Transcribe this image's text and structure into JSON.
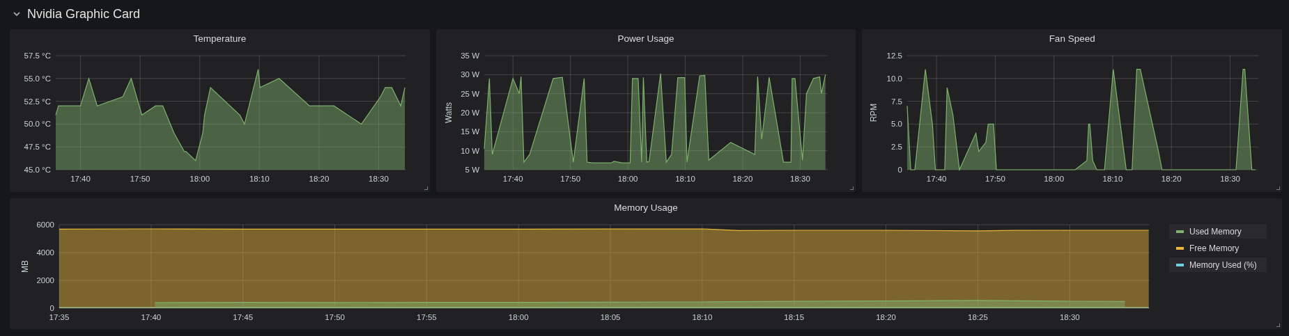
{
  "section": {
    "title": "Nvidia Graphic Card",
    "expanded": true
  },
  "panels": [
    {
      "chart_data": {
        "type": "area",
        "grid": true,
        "title": "Temperature",
        "x": [
          1055.85,
          1056.3,
          1060,
          1061.4,
          1062.8,
          1067.1,
          1068.5,
          1070.3,
          1072.6,
          1073.8,
          1075.7,
          1077.4,
          1077.7,
          1079.3,
          1080.5,
          1080.8,
          1081.8,
          1086.7,
          1087.5,
          1089.8,
          1090.1,
          1093.3,
          1098.4,
          1102.5,
          1107.1,
          1110.3,
          1111.1,
          1112.2,
          1113.7,
          1114.4
        ],
        "values": [
          51,
          52,
          52,
          55,
          52,
          53,
          55,
          51,
          52,
          52,
          49,
          47,
          47,
          46,
          49,
          51,
          54,
          51,
          50,
          56,
          54,
          55,
          52,
          52,
          50,
          53,
          54,
          54,
          52,
          54
        ],
        "xlim": [
          1055.85,
          1114.5
        ],
        "ylim": [
          45,
          57.5
        ],
        "xticks": [
          {
            "value": 1060,
            "label": "17:40"
          },
          {
            "value": 1070,
            "label": "17:50"
          },
          {
            "value": 1080,
            "label": "18:00"
          },
          {
            "value": 1090,
            "label": "18:10"
          },
          {
            "value": 1100,
            "label": "18:20"
          },
          {
            "value": 1110,
            "label": "18:30"
          }
        ],
        "yticks": [
          {
            "value": 45,
            "label": "45.0 °C"
          },
          {
            "value": 47.5,
            "label": "47.5 °C"
          },
          {
            "value": 50,
            "label": "50.0 °C"
          },
          {
            "value": 52.5,
            "label": "52.5 °C"
          },
          {
            "value": 55,
            "label": "55.0 °C"
          },
          {
            "value": 57.5,
            "label": "57.5 °C"
          }
        ]
      }
    },
    {
      "chart_data": {
        "type": "area",
        "grid": true,
        "title": "Power Usage",
        "ylabel": "Watts",
        "x": [
          1055,
          1055.9,
          1056.4,
          1060,
          1061.1,
          1061.4,
          1061.9,
          1062.9,
          1067,
          1068.6,
          1070.5,
          1072.4,
          1072.9,
          1073.8,
          1077.1,
          1077.6,
          1079,
          1080.4,
          1080.8,
          1081.8,
          1082.4,
          1082.7,
          1083.3,
          1083.7,
          1085.7,
          1086.7,
          1087.6,
          1088.7,
          1089.9,
          1090.3,
          1092.5,
          1093.4,
          1094.1,
          1097.9,
          1102.1,
          1102.6,
          1103.3,
          1104.6,
          1107.1,
          1108.4,
          1108.6,
          1109.1,
          1110.4,
          1111.1,
          1112.3,
          1113.4,
          1113.7,
          1114.4
        ],
        "values": [
          10.5,
          29,
          9,
          29,
          25,
          29.5,
          7,
          9,
          29,
          29.3,
          7,
          29,
          7,
          6.8,
          6.8,
          7.2,
          6.8,
          6.8,
          29,
          29,
          7,
          29.3,
          7,
          7.2,
          30.3,
          7,
          9,
          29.2,
          29.2,
          7,
          29.7,
          29.8,
          7.5,
          12.2,
          9,
          29.5,
          13,
          29.3,
          7,
          7,
          29,
          29,
          7.5,
          25,
          29,
          29.4,
          25,
          30
        ],
        "xlim": [
          1055,
          1114.8
        ],
        "ylim": [
          5,
          35
        ],
        "xticks": [
          {
            "value": 1060,
            "label": "17:40"
          },
          {
            "value": 1070,
            "label": "17:50"
          },
          {
            "value": 1080,
            "label": "18:00"
          },
          {
            "value": 1090,
            "label": "18:10"
          },
          {
            "value": 1100,
            "label": "18:20"
          },
          {
            "value": 1110,
            "label": "18:30"
          }
        ],
        "yticks": [
          {
            "value": 5,
            "label": "5 W"
          },
          {
            "value": 10,
            "label": "10 W"
          },
          {
            "value": 15,
            "label": "15 W"
          },
          {
            "value": 20,
            "label": "20 W"
          },
          {
            "value": 25,
            "label": "25 W"
          },
          {
            "value": 30,
            "label": "30 W"
          },
          {
            "value": 35,
            "label": "35 W"
          }
        ]
      }
    },
    {
      "chart_data": {
        "type": "area",
        "grid": true,
        "title": "Fan Speed",
        "ylabel": "RPM",
        "x": [
          1055,
          1055.6,
          1056.3,
          1058.1,
          1059.3,
          1059.8,
          1061.4,
          1061.8,
          1062.8,
          1063.9,
          1066.7,
          1067.2,
          1068.4,
          1068.8,
          1069.7,
          1070.2,
          1083.6,
          1085.6,
          1085.9,
          1086.1,
          1086.6,
          1087.3,
          1088.6,
          1090.1,
          1092.3,
          1093.3,
          1094.1,
          1094.7,
          1097.8,
          1098.4,
          1111,
          1112.2,
          1112.5,
          1113.7,
          1114.3
        ],
        "values": [
          7,
          0,
          0,
          11,
          5,
          0,
          0,
          9,
          6,
          0,
          4,
          2,
          3,
          5,
          5,
          0,
          0,
          1,
          5,
          5,
          1,
          0,
          0,
          11,
          0,
          0,
          11,
          11,
          2,
          0,
          0,
          11,
          11,
          0,
          0
        ],
        "xlim": [
          1055,
          1114.8
        ],
        "ylim": [
          0,
          12.5
        ],
        "xticks": [
          {
            "value": 1060,
            "label": "17:40"
          },
          {
            "value": 1070,
            "label": "17:50"
          },
          {
            "value": 1080,
            "label": "18:00"
          },
          {
            "value": 1090,
            "label": "18:10"
          },
          {
            "value": 1100,
            "label": "18:20"
          },
          {
            "value": 1110,
            "label": "18:30"
          }
        ],
        "yticks": [
          {
            "value": 0,
            "label": "0"
          },
          {
            "value": 2.5,
            "label": "2.5"
          },
          {
            "value": 5,
            "label": "5.0"
          },
          {
            "value": 7.5,
            "label": "7.5"
          },
          {
            "value": 10,
            "label": "10.0"
          },
          {
            "value": 12.5,
            "label": "12.5"
          }
        ]
      }
    },
    {
      "chart_data": {
        "type": "area",
        "grid": true,
        "title": "Memory Usage",
        "ylabel": "MB",
        "x": [
          1055,
          1060,
          1060.2,
          1065,
          1070,
          1075,
          1080,
          1085,
          1090,
          1092,
          1095,
          1100,
          1105,
          1107,
          1110,
          1113,
          1114.3
        ],
        "series": [
          {
            "name": "Used Memory",
            "color": "#7eb26d",
            "values": [
              null,
              null,
              400,
              420,
              410,
              420,
              420,
              430,
              450,
              470,
              490,
              520,
              560,
              530,
              500,
              480,
              null
            ]
          },
          {
            "name": "Free Memory",
            "color": "#eab839",
            "values": [
              5680,
              5700,
              5700,
              5680,
              5680,
              5680,
              5680,
              5690,
              5700,
              5580,
              5600,
              5600,
              5560,
              5590,
              5600,
              5600,
              5600
            ]
          },
          {
            "name": "Memory Used (%)",
            "color": "#6ed0e0",
            "values": [
              40,
              40,
              40,
              40,
              40,
              40,
              40,
              40,
              40,
              40,
              40,
              40,
              40,
              40,
              40,
              40,
              40
            ]
          }
        ],
        "xlim": [
          1055,
          1114.35
        ],
        "ylim": [
          0,
          6000
        ],
        "xticks": [
          {
            "value": 1055,
            "label": "17:35"
          },
          {
            "value": 1060,
            "label": "17:40"
          },
          {
            "value": 1065,
            "label": "17:45"
          },
          {
            "value": 1070,
            "label": "17:50"
          },
          {
            "value": 1075,
            "label": "17:55"
          },
          {
            "value": 1080,
            "label": "18:00"
          },
          {
            "value": 1085,
            "label": "18:05"
          },
          {
            "value": 1090,
            "label": "18:10"
          },
          {
            "value": 1095,
            "label": "18:15"
          },
          {
            "value": 1100,
            "label": "18:20"
          },
          {
            "value": 1105,
            "label": "18:25"
          },
          {
            "value": 1110,
            "label": "18:30"
          }
        ],
        "yticks": [
          0,
          2000,
          4000,
          6000
        ]
      }
    }
  ]
}
